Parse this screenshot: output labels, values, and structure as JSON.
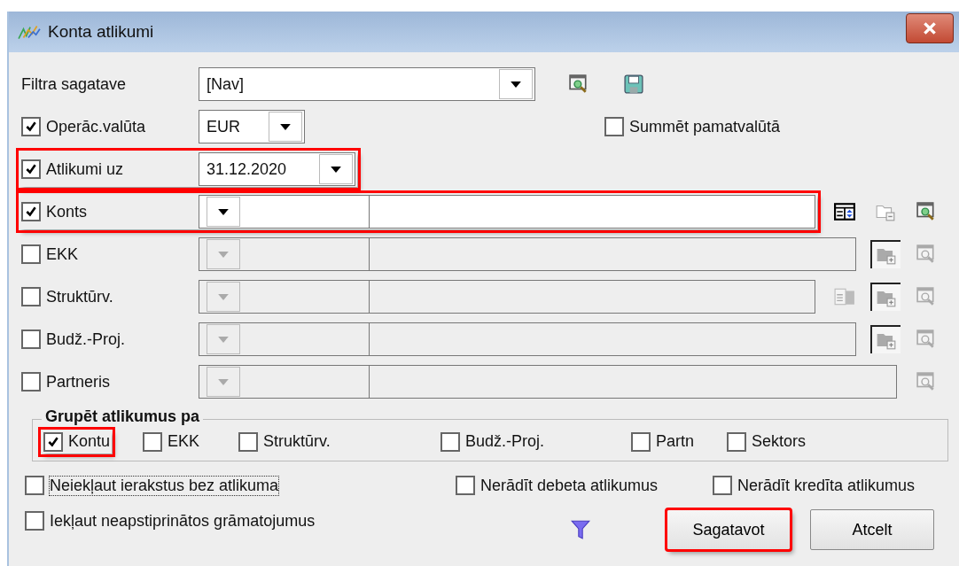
{
  "window": {
    "title": "Konta atlikumi"
  },
  "filters": [
    {
      "kind": "template",
      "label": "Filtra sagatave",
      "value": "[Nav]",
      "tools": [
        {
          "kind": "preview",
          "disabled": false
        },
        {
          "kind": "save",
          "disabled": false
        }
      ]
    },
    {
      "kind": "currency",
      "label": "Operāc.valūta",
      "checked": true,
      "value": "EUR",
      "extra": {
        "label": "Summēt pamatvalūtā",
        "checked": false
      }
    },
    {
      "kind": "date",
      "label": "Atlikumi uz",
      "checked": true,
      "highlighted": true,
      "value": "31.12.2020"
    },
    {
      "kind": "dimension",
      "label": "Konts",
      "checked": true,
      "highlighted": true,
      "tools": [
        {
          "kind": "table",
          "disabled": false
        },
        {
          "kind": "folder-minus",
          "disabled": true
        },
        {
          "kind": "preview",
          "disabled": false
        }
      ]
    },
    {
      "kind": "dimension",
      "label": "EKK",
      "checked": false,
      "highlighted": false,
      "tools": [
        {
          "kind": "folder-plus",
          "disabled": true
        },
        {
          "kind": "preview",
          "disabled": true
        }
      ]
    },
    {
      "kind": "dimension",
      "label": "Struktūrv.",
      "checked": false,
      "highlighted": false,
      "tools": [
        {
          "kind": "list",
          "disabled": true
        },
        {
          "kind": "folder-plus",
          "disabled": true
        },
        {
          "kind": "preview",
          "disabled": true
        }
      ]
    },
    {
      "kind": "dimension",
      "label": "Budž.-Proj.",
      "checked": false,
      "highlighted": false,
      "tools": [
        {
          "kind": "folder-plus",
          "disabled": true
        },
        {
          "kind": "preview",
          "disabled": true
        }
      ]
    },
    {
      "kind": "dimension",
      "label": "Partneris",
      "checked": false,
      "highlighted": false,
      "tools": [
        {
          "kind": "preview",
          "disabled": true
        }
      ]
    }
  ],
  "group": {
    "title": "Grupēt atlikumus pa",
    "options": [
      {
        "label": "Kontu",
        "checked": true,
        "highlighted": true
      },
      {
        "label": "EKK",
        "checked": false,
        "highlighted": false
      },
      {
        "label": "Struktūrv.",
        "checked": false,
        "highlighted": false
      },
      {
        "label": "Budž.-Proj.",
        "checked": false,
        "highlighted": false
      },
      {
        "label": "Partn",
        "checked": false,
        "highlighted": false
      },
      {
        "label": "Sektors",
        "checked": false,
        "highlighted": false
      }
    ]
  },
  "options": [
    {
      "label": "Neiekļaut ierakstus bez atlikuma",
      "checked": false,
      "focused": true
    },
    {
      "label": "Nerādīt debeta atlikumus",
      "checked": false,
      "focused": false
    },
    {
      "label": "Nerādīt kredīta atlikumus",
      "checked": false,
      "focused": false
    },
    {
      "label": "Iekļaut neapstiprinātos grāmatojumus",
      "checked": false,
      "focused": false
    }
  ],
  "buttons": [
    {
      "label": "Sagatavot",
      "highlighted": true
    },
    {
      "label": "Atcelt",
      "highlighted": false
    }
  ]
}
